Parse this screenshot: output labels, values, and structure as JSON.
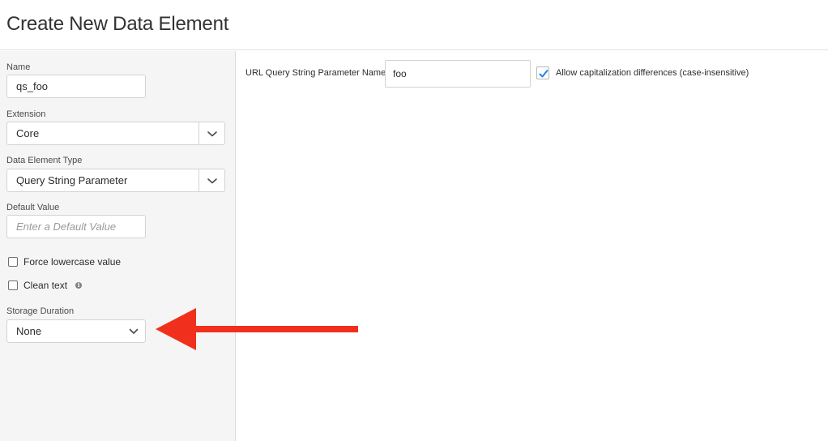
{
  "header": {
    "title": "Create New Data Element"
  },
  "sidebar": {
    "name": {
      "label": "Name",
      "value": "qs_foo"
    },
    "extension": {
      "label": "Extension",
      "selected": "Core"
    },
    "data_element_type": {
      "label": "Data Element Type",
      "selected": "Query String Parameter"
    },
    "default_value": {
      "label": "Default Value",
      "placeholder": "Enter a Default Value",
      "value": ""
    },
    "force_lowercase": {
      "label": "Force lowercase value",
      "checked": false
    },
    "clean_text": {
      "label": "Clean text",
      "checked": false,
      "info_icon": "info-icon"
    },
    "storage_duration": {
      "label": "Storage Duration",
      "selected": "None"
    }
  },
  "main": {
    "param_name_label": "URL Query String Parameter Name",
    "param_name_value": "foo",
    "case_insensitive": {
      "label": "Allow capitalization differences (case-insensitive)",
      "checked": true
    }
  },
  "annotation": {
    "arrow_color": "#f0301c",
    "points_to": "storage-duration-select"
  },
  "colors": {
    "accent": "#2680eb",
    "sidebar_bg": "#f5f5f5",
    "border": "#d3d3d3"
  }
}
